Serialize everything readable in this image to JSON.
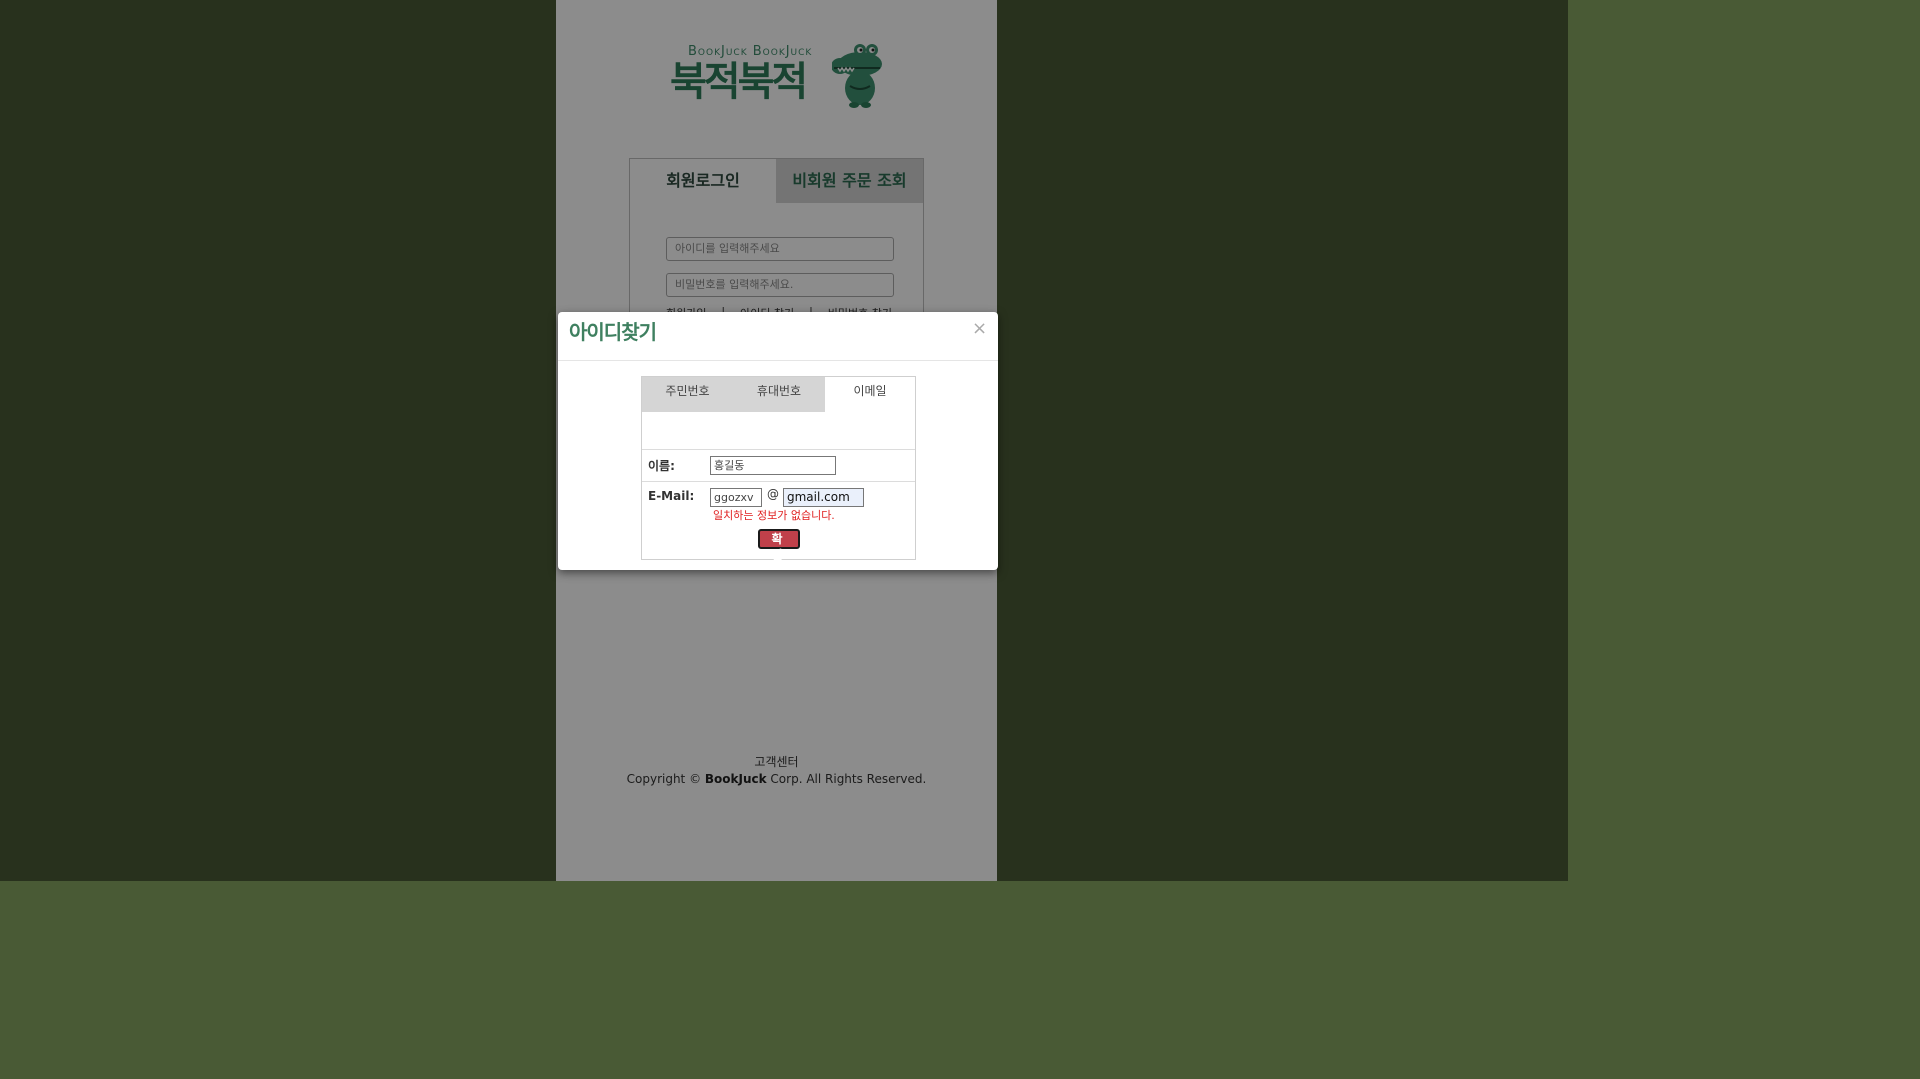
{
  "logo": {
    "english": "BookJuck BookJuck",
    "korean": "북적북적",
    "mascot_icon": "crocodile-mascot-icon"
  },
  "login": {
    "tab_member": "회원로그인",
    "tab_guest": "비회원 주문 조회",
    "id_placeholder": "아이디를 입력해주세요",
    "pw_placeholder": "비밀번호를 입력해주세요.",
    "links": [
      "회원가입",
      "|",
      "아이디 찾기",
      "|",
      "비밀번호 찾기"
    ]
  },
  "footer": {
    "center": "고객센터",
    "copyright_prefix": "Copyright © ",
    "brand": "BookJuck",
    "copyright_suffix": " Corp. All Rights Reserved."
  },
  "modal": {
    "title": "아이디찾기",
    "close": "×",
    "tabs": [
      "주민번호",
      "휴대번호",
      "이메일"
    ],
    "active_tab": "이메일",
    "name_label": "이름:",
    "name_value": "홍길동",
    "email_label": "E-Mail:",
    "email_id": "ggozxv",
    "at": "@",
    "email_domain": "gmail.com",
    "error": "일치하는 정보가 없습니다.",
    "confirm": "확 인"
  },
  "colors": {
    "background": "#495a35",
    "brand_green": "#2f7d5a",
    "error_red": "#e02020",
    "button_red": "#c0404a"
  }
}
